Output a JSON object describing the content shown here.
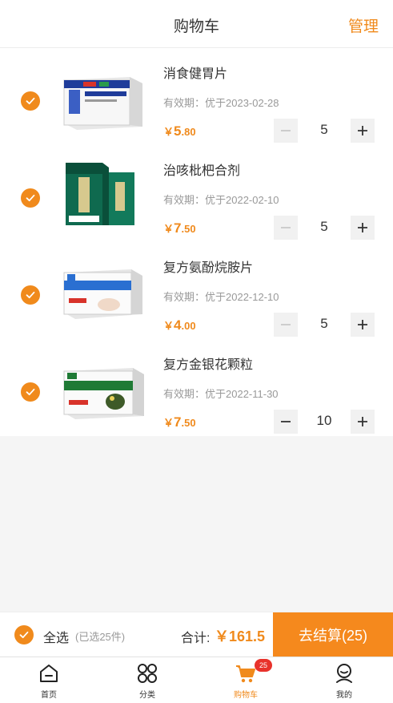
{
  "header": {
    "title": "购物车",
    "manage": "管理"
  },
  "items": [
    {
      "name": "消食健胃片",
      "expiry": "有效期：优于2023-02-28",
      "price_yen": "￥",
      "price_int": "5",
      "price_dec": ".80",
      "qty": "5",
      "minus_disabled": true,
      "box_color": "#1f3c9a",
      "box_label": "消食健胃片"
    },
    {
      "name": "治咳枇杷合剂",
      "expiry": "有效期：优于2022-02-10",
      "price_yen": "￥",
      "price_int": "7",
      "price_dec": ".50",
      "qty": "5",
      "minus_disabled": true,
      "box_color": "#0f6a4f",
      "box_label": "治咳枇杷合剂"
    },
    {
      "name": "复方氨酚烷胺片",
      "expiry": "有效期：优于2022-12-10",
      "price_yen": "￥",
      "price_int": "4",
      "price_dec": ".00",
      "qty": "5",
      "minus_disabled": true,
      "box_color": "#2a6fd1",
      "box_label": "复方氨酚烷胺片"
    },
    {
      "name": "复方金银花颗粒",
      "expiry": "有效期：优于2022-11-30",
      "price_yen": "￥",
      "price_int": "7",
      "price_dec": ".50",
      "qty": "10",
      "minus_disabled": false,
      "box_color": "#1f7a35",
      "box_label": "复方金银花颗粒"
    }
  ],
  "footer": {
    "select_all": "全选",
    "selected_count": "(已选25件)",
    "total_label": "合计:",
    "total_value": "￥161.5",
    "checkout": "去结算(25)"
  },
  "tabs": [
    {
      "label": "首页",
      "icon": "home-icon"
    },
    {
      "label": "分类",
      "icon": "category-icon"
    },
    {
      "label": "购物车",
      "icon": "cart-icon",
      "badge": "25"
    },
    {
      "label": "我的",
      "icon": "profile-icon"
    }
  ],
  "colors": {
    "accent": "#f08a1c",
    "checkout_bg": "#f5891d",
    "badge": "#e8322b"
  }
}
